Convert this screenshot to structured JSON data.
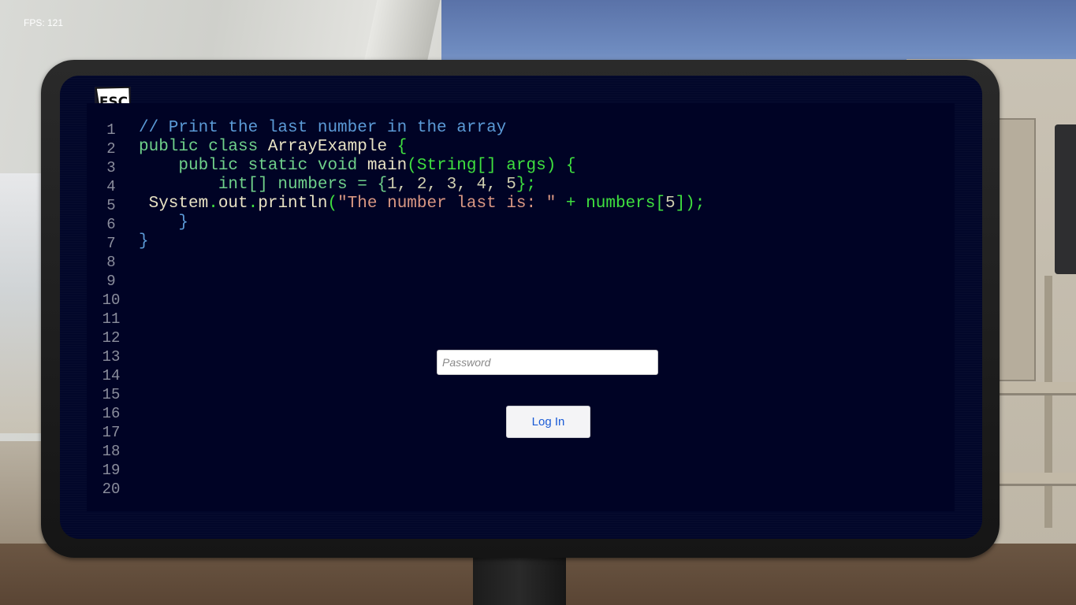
{
  "hud": {
    "fps": "FPS: 121"
  },
  "esc": {
    "label": "ESC",
    "icon": "esc-key-icon"
  },
  "editor": {
    "line_numbers": [
      "1",
      "2",
      "3",
      "4",
      "5",
      "6",
      "7",
      "8",
      "9",
      "10",
      "11",
      "12",
      "13",
      "14",
      "15",
      "16",
      "17",
      "18",
      "19",
      "20"
    ],
    "lines": [
      [
        {
          "t": "// Print the last number in the array",
          "c": "c-comment"
        }
      ],
      [
        {
          "t": "public class ",
          "c": "c-kw"
        },
        {
          "t": "ArrayExample",
          "c": "c-type"
        },
        {
          "t": " {",
          "c": "c-green"
        }
      ],
      [
        {
          "t": "    public static void ",
          "c": "c-kw"
        },
        {
          "t": "main",
          "c": "c-type"
        },
        {
          "t": "(String[] args) {",
          "c": "c-green"
        }
      ],
      [
        {
          "t": "        int[] numbers = {",
          "c": "c-kw"
        },
        {
          "t": "1, 2, 3, 4, 5",
          "c": "c-num"
        },
        {
          "t": "};",
          "c": "c-green"
        }
      ],
      [
        {
          "t": " System",
          "c": "c-type"
        },
        {
          "t": ".",
          "c": "c-green"
        },
        {
          "t": "out",
          "c": "c-type"
        },
        {
          "t": ".",
          "c": "c-green"
        },
        {
          "t": "println",
          "c": "c-type"
        },
        {
          "t": "(",
          "c": "c-green"
        },
        {
          "t": "\"The number last is: \"",
          "c": "c-str"
        },
        {
          "t": " + numbers[",
          "c": "c-green"
        },
        {
          "t": "5",
          "c": "c-num"
        },
        {
          "t": "]);",
          "c": "c-green"
        }
      ],
      [
        {
          "t": "    }",
          "c": "c-blue"
        }
      ],
      [
        {
          "t": "}",
          "c": "c-blue"
        }
      ]
    ]
  },
  "login": {
    "password_placeholder": "Password",
    "password_value": "",
    "button_label": "Log In"
  },
  "colors": {
    "screen_bg": "#02072a",
    "comment": "#5b9ad6",
    "keyword": "#6fd08a",
    "string": "#d99782",
    "button_text": "#1a5bd6"
  }
}
